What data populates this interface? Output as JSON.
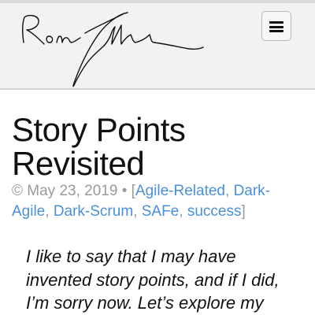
{
  "header": {
    "logo_alt": "Ron Jeffries",
    "menu_icon": "hamburger-menu-icon"
  },
  "post": {
    "title": "Story Points Revisited",
    "copyright": "©",
    "date": "May 23, 2019",
    "separator": "•",
    "bracket_open": "[",
    "bracket_close": "]",
    "categories": [
      "Agile-Related",
      "Dark-Agile",
      "Dark-Scrum",
      "SAFe",
      "success"
    ],
    "intro": "I like to say that I may have invented story points, and if I did, I’m sorry now. Let’s explore my"
  },
  "colors": {
    "link": "#4a90d9",
    "meta": "#9a9a9a",
    "header_bg": "#f2f2f2"
  }
}
